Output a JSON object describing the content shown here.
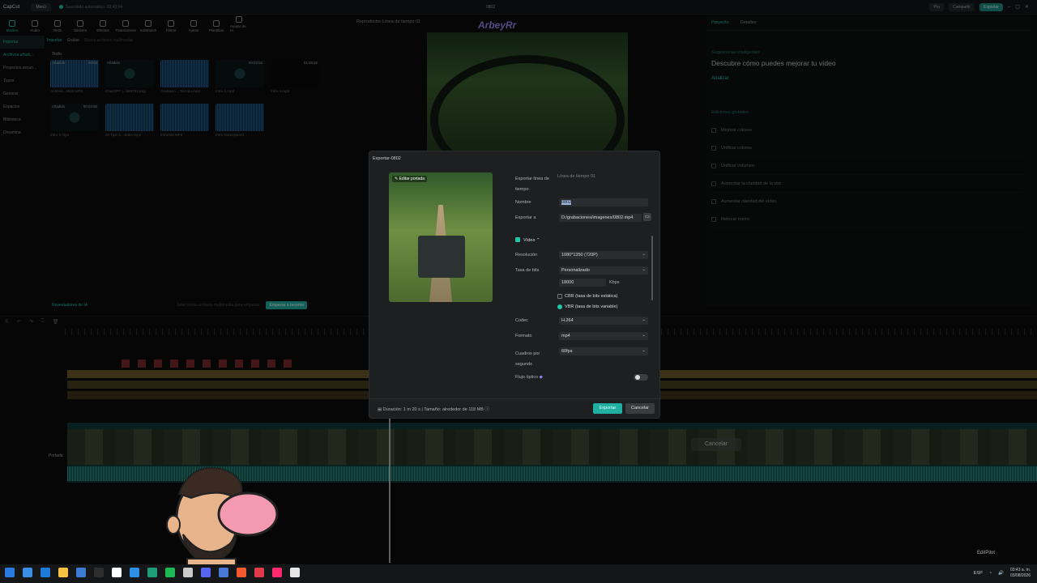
{
  "app": {
    "brand": "CapCut",
    "menu": "Menú",
    "autosave": "Guardado automático: 03:43:04",
    "window_title": "0802",
    "pro": "Pro",
    "share": "Compartir",
    "export": "Exportar"
  },
  "toolbar": {
    "items": [
      "Medios",
      "Audio",
      "Texto",
      "Stickers",
      "Efectos",
      "Transiciones",
      "Subtítulos",
      "Filtros",
      "Ajuste",
      "Plantillas",
      "Avatar de IA"
    ]
  },
  "left_nav": {
    "items": [
      "Importar",
      "Archivos añadi...",
      "Proyectos secun...",
      "Tuyos",
      "General",
      "Espacios",
      "Biblioteca",
      "Dreamina"
    ]
  },
  "media": {
    "import_btn": "Importar",
    "record_btn": "Grabar",
    "search_placeholder": "Busca archivos multimedia",
    "filter": "Todo",
    "items": [
      {
        "badge": "Añadido",
        "name": "Untitled...3632.MP4",
        "time": "00:03"
      },
      {
        "badge": "Añadido",
        "name": "ChatGPT I...b89782.png",
        "time": ""
      },
      {
        "badge": "",
        "name": "Grabacio....Tiempo.mp3",
        "time": ""
      },
      {
        "badge": "",
        "name": "Intro 1.mp4",
        "time": "00:03:52"
      },
      {
        "badge": "",
        "name": "Intro 4.mp4",
        "time": "01:38:22"
      },
      {
        "badge": "Añadido",
        "name": "Intro 2.mp4",
        "time": "00:03:50"
      },
      {
        "badge": "",
        "name": "20 Tips S...video.mp4",
        "time": ""
      },
      {
        "badge": "",
        "name": "Intro2x8.MP4",
        "time": ""
      },
      {
        "badge": "",
        "name": "Intro Spacepanel",
        "time": ""
      }
    ],
    "ai_text": "Reventadores de IA",
    "ai_hint": "Selecciona archivos multimedia para empezar",
    "ai_btn": "Empezar a recortar"
  },
  "player": {
    "title": "Reproductor-Línea de tiempo 01",
    "logo": "ArbeyRr"
  },
  "right_panel": {
    "tabs": [
      "Proyecto",
      "Detalles"
    ],
    "sub": "Sugerencias inteligentes",
    "title": "Descubre cómo puedes mejorar tu vídeo",
    "analyze": "Analizar",
    "section": "Ediciones globales",
    "items": [
      "Mejorar colores",
      "Unificar colores",
      "Unificar volumen",
      "Aumentar la claridad de la voz",
      "Aumentar claridad del vídeo",
      "Retocar rostro"
    ]
  },
  "dialog": {
    "title": "Exportar-0802",
    "edit_cover": "Editar portada",
    "export_timeline_label": "Exportar línea de tiempo",
    "export_timeline_value": "Línea de tiempo 01",
    "name_label": "Nombre",
    "name_value": "0802",
    "export_to_label": "Exportar a",
    "export_to_value": "D:/grabaciones/imagenes/0802.mp4",
    "video_label": "Vídeo",
    "resolution_label": "Resolución",
    "resolution_value": "1080*1350 (720P)",
    "bitrate_label": "Tasa de bits",
    "bitrate_value": "Personalizado",
    "bitrate_kbps": "18000",
    "kbps_unit": "Kbps",
    "cbr": "CBR (tasa de bits estática)",
    "vbr": "VBR (tasa de bits variable)",
    "codec_label": "Codec",
    "codec_value": "H.264",
    "format_label": "Formato",
    "format_value": "mp4",
    "fps_label": "Cuadros por segundo",
    "fps_value": "60fps",
    "optical_flow_label": "Flujo óptico",
    "footer_info": "Duración: 1 m 20 s | Tamaño: alrededor de 118 MB",
    "export_btn": "Exportar",
    "cancel_btn": "Cancelar"
  },
  "timeline": {
    "cover_label": "Portada",
    "cancel_float": "Cancelar"
  },
  "taskbar": {
    "lang": "ESP",
    "time": "03:43 a. m.",
    "date": "03/08/2026"
  },
  "editpilot": "EditPilot"
}
